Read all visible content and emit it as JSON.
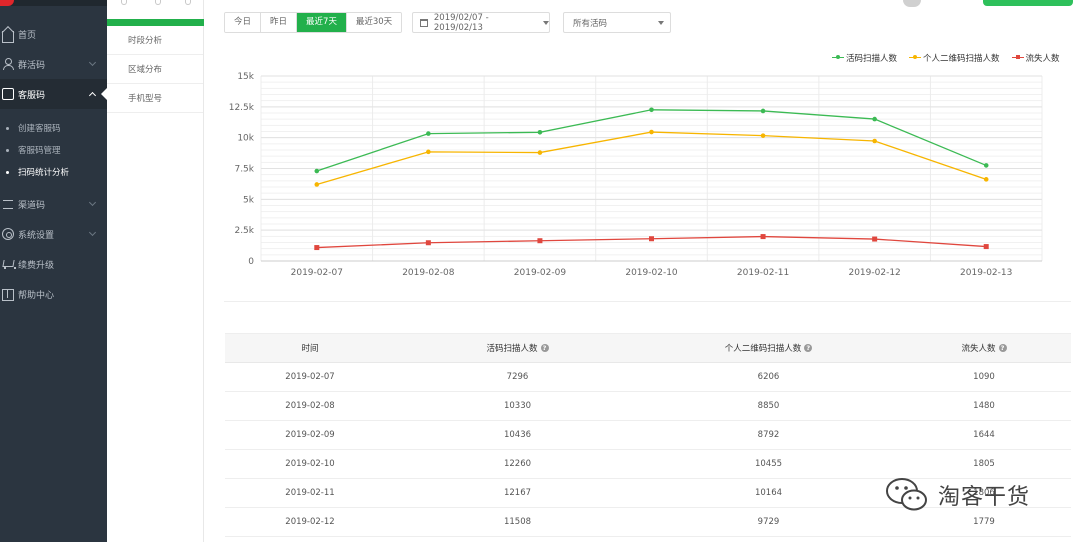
{
  "sidebar": {
    "items": [
      {
        "label": "首页",
        "icon": "home-icon"
      },
      {
        "label": "群活码",
        "icon": "user-group-icon"
      },
      {
        "label": "客服码",
        "icon": "phone-icon"
      },
      {
        "label": "渠道码",
        "icon": "channel-icon"
      },
      {
        "label": "系统设置",
        "icon": "gear-icon"
      },
      {
        "label": "续费升级",
        "icon": "cart-icon"
      },
      {
        "label": "帮助中心",
        "icon": "book-icon"
      }
    ],
    "sub_items": [
      {
        "label": "创建客服码"
      },
      {
        "label": "客服码管理"
      },
      {
        "label": "扫码统计分析"
      }
    ]
  },
  "submenu": {
    "items": [
      {
        "label": "时段分析"
      },
      {
        "label": "区域分布"
      },
      {
        "label": "手机型号"
      }
    ]
  },
  "filters": {
    "range_buttons": [
      {
        "label": "今日"
      },
      {
        "label": "昨日"
      },
      {
        "label": "最近7天"
      },
      {
        "label": "最近30天"
      }
    ],
    "active_range": "最近7天",
    "date_range": "2019/02/07 - 2019/02/13",
    "code_select": "所有活码"
  },
  "colors": {
    "accent": "#22b04b",
    "series_active": "#3cba54",
    "series_personal": "#f7b500",
    "series_lost": "#e0473e"
  },
  "chart_data": {
    "type": "line",
    "x": [
      "2019-02-07",
      "2019-02-08",
      "2019-02-09",
      "2019-02-10",
      "2019-02-11",
      "2019-02-12",
      "2019-02-13"
    ],
    "series": [
      {
        "name": "活码扫描人数",
        "values": [
          7296,
          10330,
          10436,
          12260,
          12167,
          11508,
          7750
        ]
      },
      {
        "name": "个人二维码扫描人数",
        "values": [
          6206,
          8850,
          8792,
          10455,
          10164,
          9729,
          6620
        ]
      },
      {
        "name": "流失人数",
        "values": [
          1090,
          1480,
          1644,
          1805,
          1980,
          1779,
          1170
        ]
      }
    ],
    "y_ticks": [
      "0",
      "2.5k",
      "5k",
      "7.5k",
      "10k",
      "12.5k",
      "15k"
    ],
    "ylim": [
      0,
      15000
    ],
    "grid": true,
    "legend_position": "top-right"
  },
  "table": {
    "headers": [
      "时间",
      "活码扫描人数",
      "个人二维码扫描人数",
      "流失人数"
    ],
    "help_icon": "?",
    "rows": [
      [
        "2019-02-07",
        "7296",
        "6206",
        "1090"
      ],
      [
        "2019-02-08",
        "10330",
        "8850",
        "1480"
      ],
      [
        "2019-02-09",
        "10436",
        "8792",
        "1644"
      ],
      [
        "2019-02-10",
        "12260",
        "10455",
        "1805"
      ],
      [
        "2019-02-11",
        "12167",
        "10164",
        "1806"
      ],
      [
        "2019-02-12",
        "11508",
        "9729",
        "1779"
      ]
    ]
  },
  "watermark": {
    "text": "淘客干货"
  }
}
